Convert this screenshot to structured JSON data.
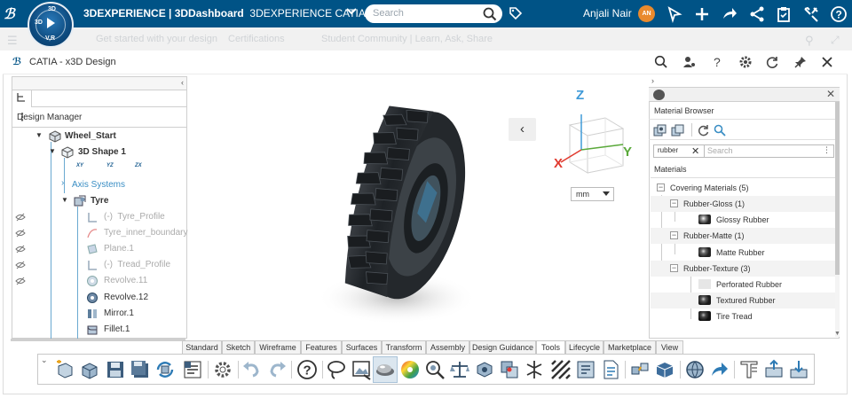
{
  "topbar": {
    "brand": "3DEXPERIENCE | 3DDashboard",
    "dashboard_title": "3DEXPERIENCE CATIA ...",
    "search_placeholder": "Search",
    "user_name": "Anjali Nair",
    "user_initials": "AN",
    "compass_labels": {
      "top": "3D",
      "left": "3D",
      "bottom": "V,R"
    }
  },
  "dashboard_strip": {
    "items": [
      "Get started with your design",
      "Certifications",
      "Student Community | Learn, Ask, Share"
    ]
  },
  "app": {
    "title": "CATIA - x3D Design"
  },
  "left_panel": {
    "header": "Design Manager",
    "tree": [
      {
        "label": "Wheel_Start",
        "bold": true
      },
      {
        "label": "3D Shape 1",
        "bold": true
      },
      {
        "label": "Axis Systems"
      },
      {
        "label": "Tyre",
        "bold": true
      },
      {
        "label": "Tyre_Profile",
        "prefix": "(-)"
      },
      {
        "label": "Tyre_inner_boundary"
      },
      {
        "label": "Plane.1"
      },
      {
        "label": "Tread_Profile",
        "prefix": "(-)"
      },
      {
        "label": "Revolve.11"
      },
      {
        "label": "Revolve.12"
      },
      {
        "label": "Mirror.1"
      },
      {
        "label": "Fillet.1"
      }
    ],
    "plane_labels": [
      "XY",
      "YZ",
      "ZX"
    ]
  },
  "viewport": {
    "unit": "mm",
    "axes": {
      "x": "X",
      "y": "Y",
      "z": "Z"
    }
  },
  "material_browser": {
    "title": "Material Browser",
    "search_chip": "rubber",
    "search_placeholder": "Search",
    "section_label": "Materials",
    "items": [
      {
        "label": "Covering Materials (5)",
        "level": 0,
        "type": "group"
      },
      {
        "label": "Rubber-Gloss (1)",
        "level": 1,
        "type": "group"
      },
      {
        "label": "Glossy Rubber",
        "level": 2,
        "type": "material"
      },
      {
        "label": "Rubber-Matte (1)",
        "level": 1,
        "type": "group"
      },
      {
        "label": "Matte Rubber",
        "level": 2,
        "type": "material"
      },
      {
        "label": "Rubber-Texture (3)",
        "level": 1,
        "type": "group"
      },
      {
        "label": "Perforated Rubber",
        "level": 2,
        "type": "material"
      },
      {
        "label": "Textured Rubber",
        "level": 2,
        "type": "material"
      },
      {
        "label": "Tire Tread",
        "level": 2,
        "type": "material"
      }
    ]
  },
  "action_bar": {
    "tabs": [
      "Standard",
      "Sketch",
      "Wireframe",
      "Features",
      "Surfaces",
      "Transform",
      "Assembly",
      "Design Guidance",
      "Tools",
      "Lifecycle",
      "Marketplace",
      "View"
    ],
    "active_tab": "Tools"
  },
  "colors": {
    "topbar": "#005386",
    "accent": "#3a8ec4",
    "x_axis": "#e03a2f",
    "y_axis": "#5aa93a",
    "z_axis": "#3f9ad8"
  }
}
